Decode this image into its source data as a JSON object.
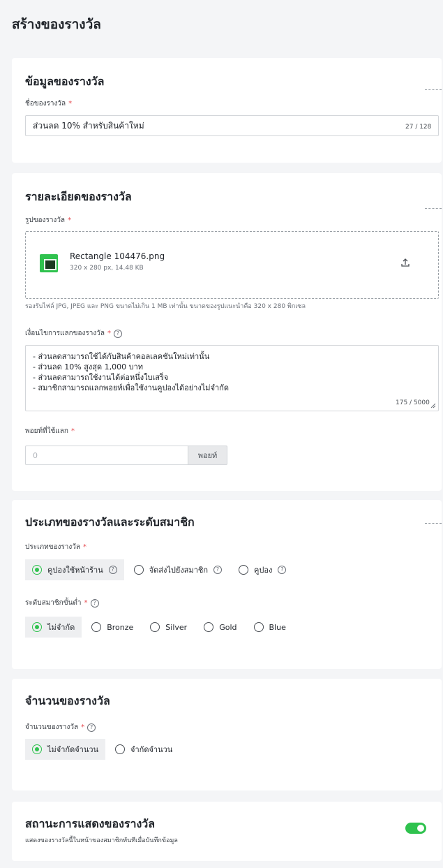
{
  "page": {
    "title": "สร้างของรางวัล"
  },
  "reward_info": {
    "title": "ข้อมูลของรางวัล",
    "name_label": "ชื่อของรางวัล",
    "required_mark": "*",
    "name_value": "ส่วนลด 10% สำหรับสินค้าใหม่",
    "name_counter": "27 / 128"
  },
  "reward_details": {
    "title": "รายละเอียดของรางวัล",
    "image_label": "รูปของรางวัล",
    "file_name": "Rectangle 104476.png",
    "file_meta": "320 x 280 px, 14.48 KB",
    "upload_hint": "รองรับไฟล์ JPG, JPEG และ PNG ขนาดไม่เกิน 1 MB เท่านั้น ขนาดของรูปแนะนำคือ 320 x 280 พิกเซล",
    "conditions_label": "เงื่อนไขการแลกของรางวัล",
    "conditions_lines": [
      "- ส่วนลดสามารถใช้ได้กับสินค้าคอลเลคชันใหม่เท่านั้น",
      "- ส่วนลด 10% สูงสุด 1,000 บาท",
      "- ส่วนลดสามารถใช้งานได้ต่อหนึ่งใบเสร็จ",
      "- สมาชิกสามารถแลกพอยท์เพื่อใช้งานคูปองได้อย่างไม่จำกัด"
    ],
    "conditions_counter": "175 / 5000",
    "points_label": "พอยท์ที่ใช้แลก",
    "points_placeholder": "0",
    "points_unit": "พอยท์"
  },
  "reward_type": {
    "title": "ประเภทของรางวัลและระดับสมาชิก",
    "type_label": "ประเภทของรางวัล",
    "type_options": [
      {
        "label": "คูปองใช้หน้าร้าน",
        "selected": true
      },
      {
        "label": "จัดส่งไปยังสมาชิก",
        "selected": false
      },
      {
        "label": "คูปอง",
        "selected": false
      }
    ],
    "tier_label": "ระดับสมาชิกขั้นต่ำ",
    "tier_options": [
      {
        "label": "ไม่จำกัด",
        "selected": true
      },
      {
        "label": "Bronze",
        "selected": false
      },
      {
        "label": "Silver",
        "selected": false
      },
      {
        "label": "Gold",
        "selected": false
      },
      {
        "label": "Blue",
        "selected": false
      }
    ]
  },
  "reward_quantity": {
    "title": "จำนวนของรางวัล",
    "quantity_label": "จำนวนของรางวัล",
    "options": [
      {
        "label": "ไม่จำกัดจำนวน",
        "selected": true
      },
      {
        "label": "จำกัดจำนวน",
        "selected": false
      }
    ]
  },
  "display_status": {
    "title": "สถานะการแสดงของรางวัล",
    "description": "แสดงของรางวัลนี้ในหน้าของสมาชิกทันทีเมื่อบันทึกข้อมูล",
    "enabled": true
  },
  "icons": {
    "help": "?",
    "upload": "upload-icon",
    "file": "image-file-icon"
  },
  "colors": {
    "accent": "#2fc24e",
    "required": "#e5484d",
    "background": "#f4f5f7"
  }
}
